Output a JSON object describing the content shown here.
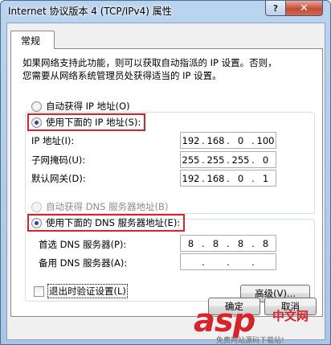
{
  "window": {
    "title": "Internet 协议版本 4 (TCP/IPv4) 属性",
    "help_button": "?",
    "close_button": "✕"
  },
  "tab": {
    "label": "常规"
  },
  "description": {
    "line1": "如果网络支持此功能，则可以获取自动指派的 IP 设置。否则，",
    "line2": "您需要从网络系统管理员处获得适当的 IP 设置。"
  },
  "ip_mode": {
    "auto_label": "自动获得 IP 地址(O)",
    "manual_label": "使用下面的 IP 地址(S):",
    "selected": "manual"
  },
  "ip_fields": {
    "ip_label": "IP 地址(I):",
    "ip_value": [
      "192",
      "168",
      "0",
      "100"
    ],
    "mask_label": "子网掩码(U):",
    "mask_value": [
      "255",
      "255",
      "255",
      "0"
    ],
    "gateway_label": "默认网关(D):",
    "gateway_value": [
      "192",
      "168",
      "0",
      "1"
    ]
  },
  "dns_mode": {
    "auto_label": "自动获得 DNS 服务器地址(B)",
    "manual_label": "使用下面的 DNS 服务器地址(E):",
    "selected": "manual"
  },
  "dns_fields": {
    "preferred_label": "首选 DNS 服务器(P):",
    "preferred_value": [
      "8",
      "8",
      "8",
      "8"
    ],
    "alternate_label": "备用 DNS 服务器(A):",
    "alternate_value": [
      "",
      "",
      "",
      ""
    ]
  },
  "validate_on_exit": {
    "label": "退出时验证设置(L)",
    "checked": false
  },
  "buttons": {
    "advanced": "高级(V)...",
    "ok": "确定",
    "cancel": "取消"
  },
  "watermark": {
    "brand": "asp",
    "cn": "中文网",
    "sub": "免费网站源码下载站!"
  },
  "colors": {
    "highlight": "#d8232a",
    "title_bar": "#b9d4ee",
    "radio_checked": "#1b4ea0"
  },
  "icons": {
    "help": "question-mark-icon",
    "close": "close-x-icon"
  }
}
